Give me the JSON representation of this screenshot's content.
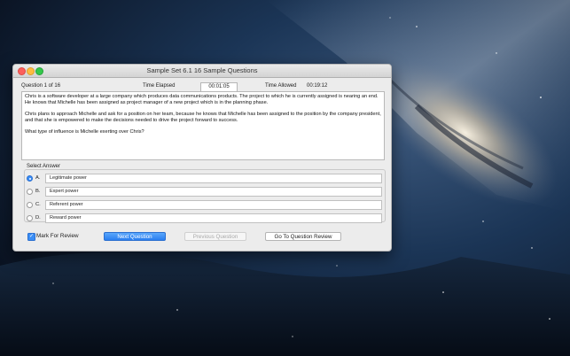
{
  "window": {
    "title": "Sample Set 6.1 16 Sample Questions"
  },
  "header": {
    "question_counter": "Question 1 of 16",
    "time_elapsed_label": "Time Elapsed",
    "time_elapsed_value": "00:01:05",
    "time_allowed_label": "Time Allowed",
    "time_allowed_value": "00:19:12"
  },
  "question": {
    "paragraph1": "Chris is a software developer at a large company which produces data communications products. The project to which he is currently assigned is nearing an end. He knows that Michelle has been assigned as project manager of a new project which is in the planning phase.",
    "paragraph2": "Chris plans to approach Michelle and ask for a position on her team, because he knows that Michelle has been assigned to the position by the company president, and that she is empowered to make the decisions needed to drive the project forward to success.",
    "paragraph3": "What type of influence is Michelle exerting over Chris?"
  },
  "answers": {
    "group_label": "Select Answer",
    "selected": "A",
    "options": [
      {
        "letter": "A.",
        "text": "Legitimate power"
      },
      {
        "letter": "B.",
        "text": "Expert power"
      },
      {
        "letter": "C.",
        "text": "Referent power"
      },
      {
        "letter": "D.",
        "text": "Reward power"
      }
    ]
  },
  "footer": {
    "mark_review_label": "Mark For Review",
    "mark_review_checked": true,
    "next_label": "Next Question",
    "previous_label": "Previous Question",
    "goto_review_label": "Go To Question Review"
  },
  "colors": {
    "accent": "#3b8ef5",
    "window_bg": "#ececec"
  }
}
